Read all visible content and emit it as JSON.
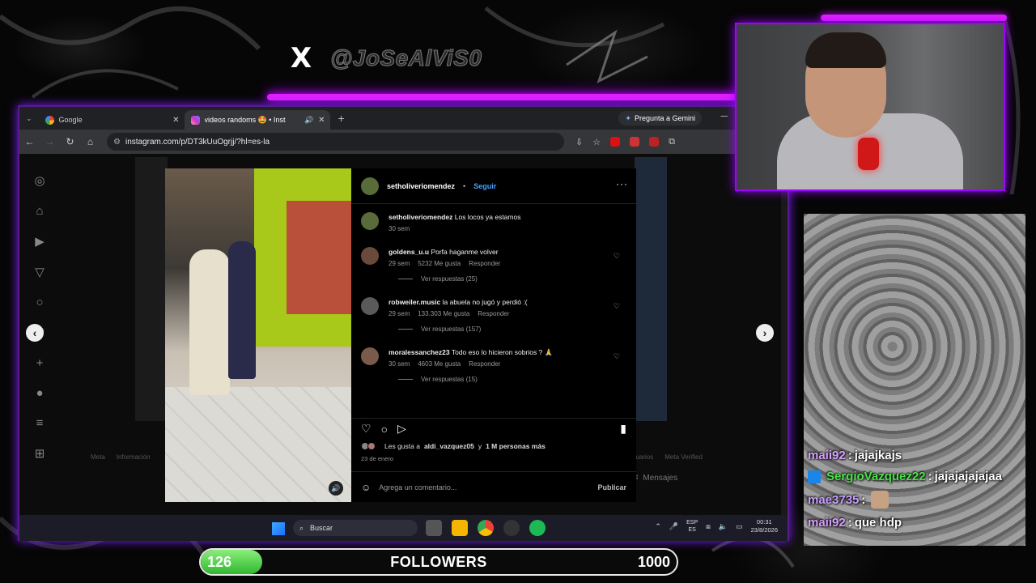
{
  "overlay": {
    "x_handle": "@JoSeAlViS0",
    "chat": [
      {
        "user": "maii92",
        "color": "#d6a0ff",
        "message": "jajajkajs",
        "badge": false
      },
      {
        "user": "SergioVazquez22",
        "color": "#4ae34a",
        "message": "jajajajajajaa",
        "badge": true
      },
      {
        "user": "mae3735",
        "color": "#c8a0ff",
        "message": "",
        "badge": false,
        "emote": true
      },
      {
        "user": "maii92",
        "color": "#d6a0ff",
        "message": "que hdp",
        "badge": false
      }
    ],
    "followers": {
      "current": "126",
      "label": "FOLLOWERS",
      "goal": "1000",
      "progress_fraction": 0.126
    }
  },
  "browser": {
    "tabs": [
      {
        "title": "Google",
        "active": false
      },
      {
        "title": "videos randoms 🤩 • Insta",
        "active": true
      }
    ],
    "gemini_button": "Pregunta a Gemini",
    "url": "instagram.com/p/DT3kUuOgrjj/?hl=es-la"
  },
  "instagram": {
    "author": "setholiveriomendez",
    "follow_label": "Seguir",
    "caption": {
      "user": "setholiveriomendez",
      "text": "Los locos ya estamos",
      "time": "30 sem"
    },
    "comments": [
      {
        "user": "goldens_u.u",
        "text": "Porfa haganme volver",
        "time": "29 sem",
        "likes": "5232 Me gusta",
        "reply": "Responder",
        "replies": "Ver respuestas (25)"
      },
      {
        "user": "robweiler.music",
        "text": "la abuela no jugó y perdió :(",
        "time": "29 sem",
        "likes": "133.303 Me gusta",
        "reply": "Responder",
        "replies": "Ver respuestas (157)"
      },
      {
        "user": "moralessanchez23",
        "text": "Todo eso lo hicieron sobrios ? 🙏",
        "time": "30 sem",
        "likes": "4603 Me gusta",
        "reply": "Responder",
        "replies": "Ver respuestas (15)"
      }
    ],
    "likes_prefix": "Les gusta a",
    "likes_user": "aldi_vazquez05",
    "likes_suffix": "y",
    "likes_others": "1 M personas más",
    "date": "23 de enero",
    "comment_placeholder": "Agrega un comentario...",
    "post_label": "Publicar",
    "footer_left": [
      "Meta",
      "Información"
    ],
    "footer_right": [
      "usuarios",
      "Meta Verified"
    ],
    "messages_label": "Mensajes"
  },
  "taskbar": {
    "search": "Buscar",
    "lang_top": "ESP",
    "lang_bottom": "ES",
    "time": "00:31",
    "date": "23/8/2026"
  }
}
